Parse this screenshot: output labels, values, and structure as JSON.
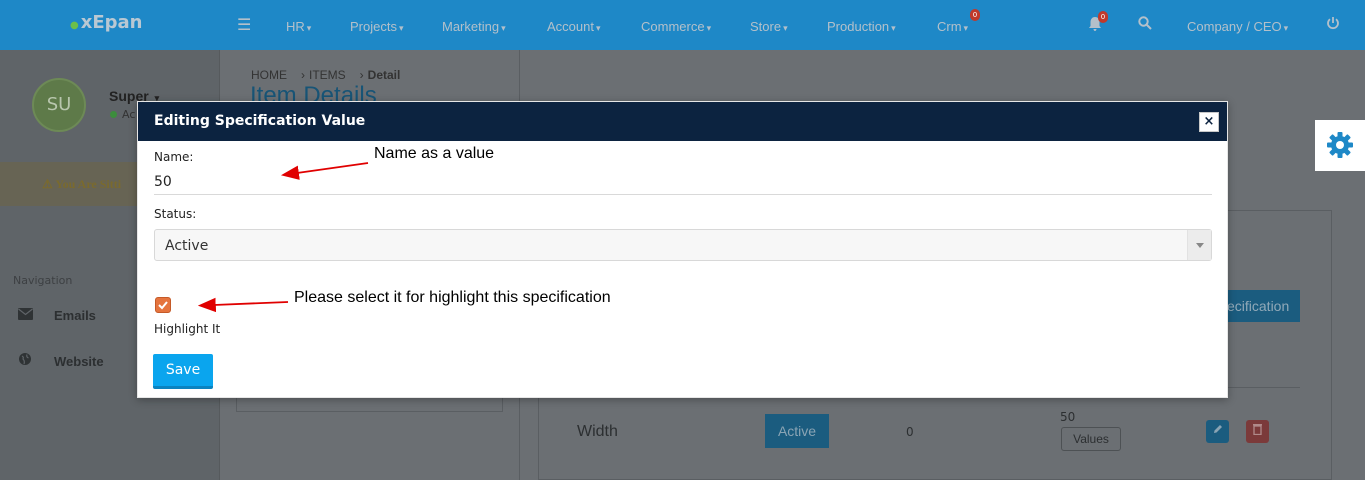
{
  "app": {
    "logo": "xEpan",
    "logo_dot": "●"
  },
  "topnav": {
    "menu_icon": "hamburger-icon",
    "items": [
      {
        "label": "HR"
      },
      {
        "label": "Projects"
      },
      {
        "label": "Marketing"
      },
      {
        "label": "Account"
      },
      {
        "label": "Commerce"
      },
      {
        "label": "Store"
      },
      {
        "label": "Production"
      },
      {
        "label": "Crm",
        "badge": "0"
      }
    ],
    "notification_badge": "0",
    "user_menu": "Company / CEO",
    "caret": "▾",
    "icons": [
      "bell-icon",
      "search-icon",
      "power-icon"
    ]
  },
  "sidebar": {
    "avatar_initials": "SU",
    "user_name": "Super",
    "user_status": "Ac",
    "alert_text": "⚠ You Are Sitti",
    "nav_title": "Navigation",
    "links": [
      {
        "label": "Emails",
        "icon": "envelope-icon"
      },
      {
        "label": "Website",
        "icon": "globe-icon"
      }
    ]
  },
  "main": {
    "breadcrumb": [
      "HOME",
      "ITEMS",
      "Detail"
    ],
    "page_title": "Item Details",
    "bg_button_label": "ecification",
    "row": {
      "name": "Width",
      "status": "Active",
      "count": "0",
      "value": "50",
      "values_button": "Values"
    }
  },
  "modal": {
    "title": "Editing Specification Value",
    "close_label": "×",
    "name_label": "Name:",
    "name_value": "50",
    "status_label": "Status:",
    "status_value": "Active",
    "highlight_label": "Highlight It",
    "highlight_checked": true,
    "save_label": "Save"
  },
  "annotations": {
    "name_note": "Name as a value",
    "highlight_note": "Please select it for highlight this specification",
    "arrow_color": "#e00000"
  },
  "colors": {
    "topbar": "#1e88c7",
    "modal_header": "#0c2340",
    "save_button": "#0aa5ee",
    "checkbox": "#e5743e"
  }
}
